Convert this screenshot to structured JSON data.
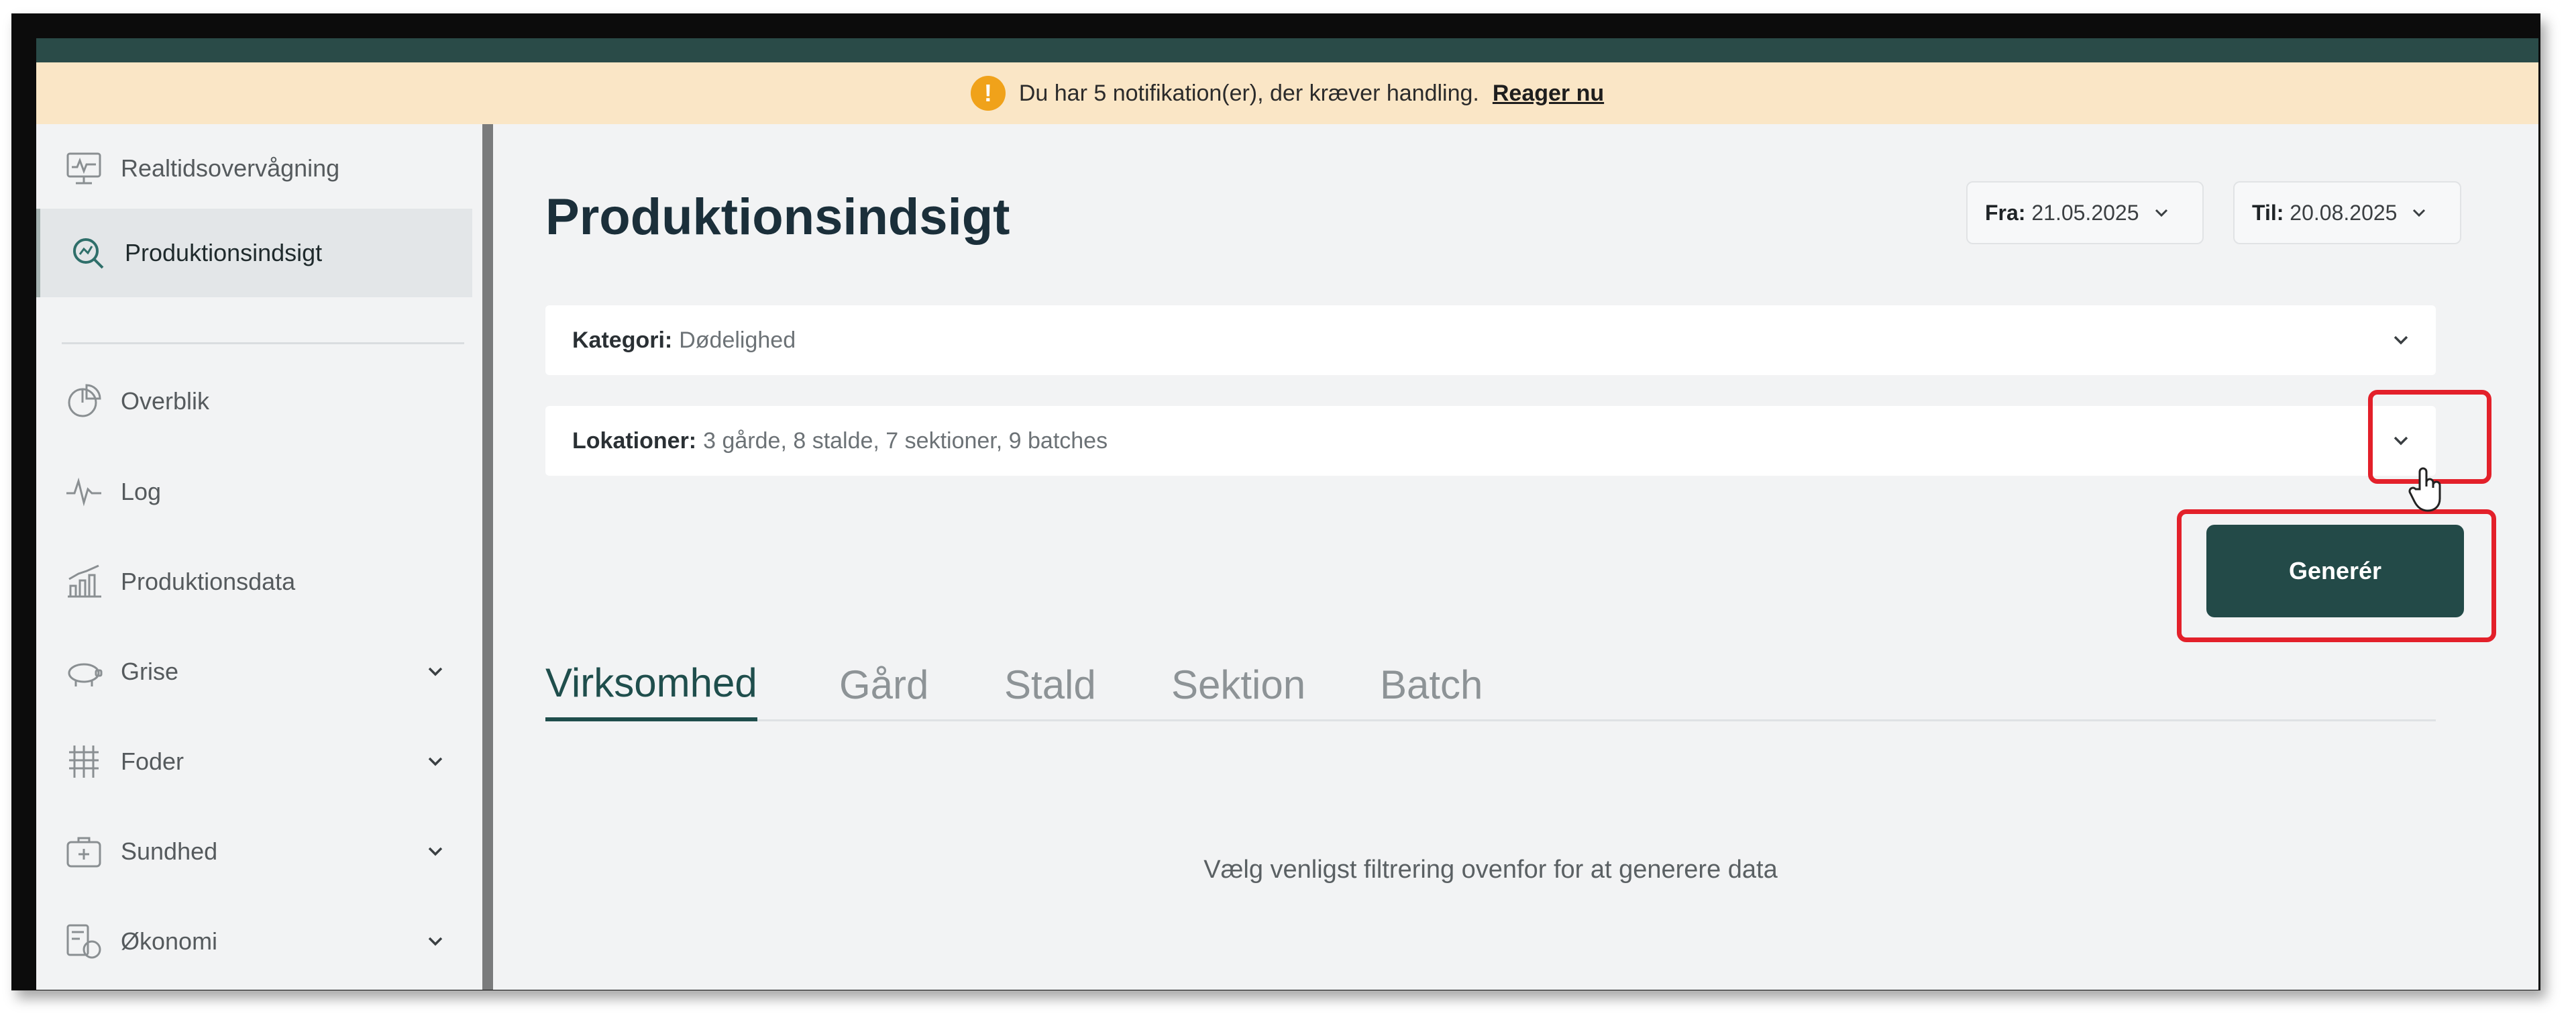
{
  "notification": {
    "text": "Du har 5 notifikation(er), der kræver handling.",
    "link": "Reager nu"
  },
  "sidebar": {
    "items": [
      {
        "label": "Realtidsovervågning",
        "icon": "monitor-icon"
      },
      {
        "label": "Produktionsindsigt",
        "icon": "search-chart-icon",
        "active": true
      },
      {
        "label": "Overblik",
        "icon": "pie-chart-icon"
      },
      {
        "label": "Log",
        "icon": "pulse-icon"
      },
      {
        "label": "Produktionsdata",
        "icon": "bar-chart-icon"
      },
      {
        "label": "Grise",
        "icon": "pig-icon",
        "expandable": true
      },
      {
        "label": "Foder",
        "icon": "grain-icon",
        "expandable": true
      },
      {
        "label": "Sundhed",
        "icon": "medical-bag-icon",
        "expandable": true
      },
      {
        "label": "Økonomi",
        "icon": "coins-icon",
        "expandable": true
      }
    ]
  },
  "main": {
    "title": "Produktionsindsigt",
    "date_from": {
      "label": "Fra:",
      "value": "21.05.2025"
    },
    "date_to": {
      "label": "Til:",
      "value": "20.08.2025"
    },
    "category": {
      "label": "Kategori:",
      "value": "Dødelighed"
    },
    "locations": {
      "label": "Lokationer:",
      "value": "3 gårde, 8 stalde, 7 sektioner, 9 batches"
    },
    "generate_label": "Generér",
    "tabs": [
      {
        "label": "Virksomhed",
        "active": true
      },
      {
        "label": "Gård"
      },
      {
        "label": "Stald"
      },
      {
        "label": "Sektion"
      },
      {
        "label": "Batch"
      }
    ],
    "empty_message": "Vælg venligst filtrering ovenfor for at generere data"
  },
  "colors": {
    "accent": "#234a48",
    "highlight": "#e3202a",
    "notice_bg": "#fae6c6",
    "notice_icon": "#f0a21a"
  }
}
